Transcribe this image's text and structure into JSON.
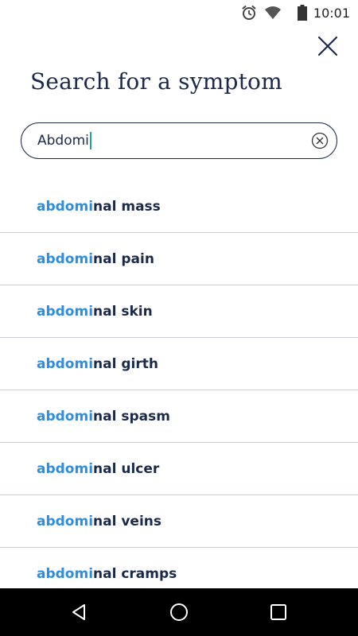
{
  "status_bar": {
    "time": "10:01",
    "icons": [
      "alarm-icon",
      "wifi-icon",
      "battery-icon"
    ]
  },
  "header": {
    "title": "Search for a symptom",
    "close_icon": "close-icon"
  },
  "search": {
    "value": "Abdomi",
    "clear_icon": "clear-circle-icon"
  },
  "results": [
    {
      "match": "abdomi",
      "rest": "nal mass"
    },
    {
      "match": "abdomi",
      "rest": "nal pain"
    },
    {
      "match": "abdomi",
      "rest": "nal skin"
    },
    {
      "match": "abdomi",
      "rest": "nal girth"
    },
    {
      "match": "abdomi",
      "rest": "nal spasm"
    },
    {
      "match": "abdomi",
      "rest": "nal ulcer"
    },
    {
      "match": "abdomi",
      "rest": "nal veins"
    },
    {
      "match": "abdomi",
      "rest": "nal cramps"
    }
  ],
  "nav_bar": {
    "buttons": [
      "back-icon",
      "home-icon",
      "recents-icon"
    ]
  },
  "colors": {
    "accent": "#2a8fe2",
    "text": "#1b2a4a",
    "caret": "#18a79e",
    "divider": "#c9cdd3"
  }
}
